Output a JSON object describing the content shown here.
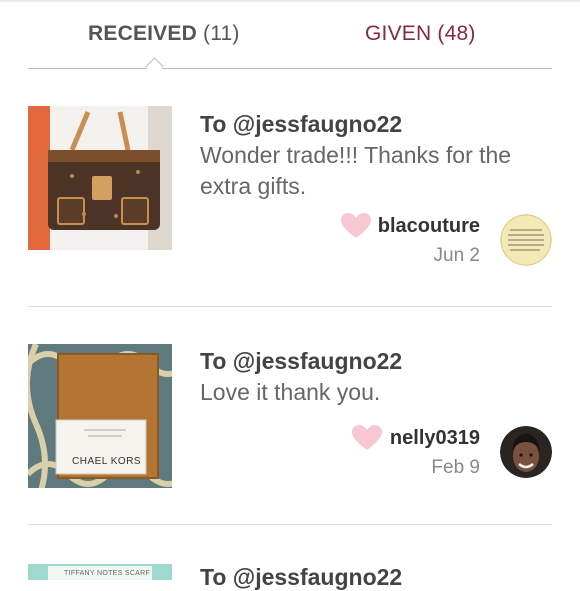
{
  "tabs": {
    "received": {
      "label": "RECEIVED",
      "count": "(11)"
    },
    "given": {
      "label": "GIVEN",
      "count": "(48)"
    }
  },
  "items": [
    {
      "to": "To @jessfaugno22",
      "comment": "Wonder trade!!! Thanks for the extra gifts.",
      "username": "blacouture",
      "date": "Jun 2",
      "thumb_icon": "handbag-photo",
      "avatar_icon": "text-avatar"
    },
    {
      "to": "To @jessfaugno22",
      "comment": "Love it thank you.",
      "username": "nelly0319",
      "date": "Feb 9",
      "thumb_icon": "wallet-photo",
      "thumb_caption": "CHAEL KORS",
      "avatar_icon": "person-avatar"
    },
    {
      "to": "To @jessfaugno22",
      "thumb_icon": "scarf-box-photo",
      "thumb_caption": "TIFFANY NOTES SCARF"
    }
  ],
  "colors": {
    "given_tab": "#822b3e",
    "heart": "#f7c8d2",
    "divider": "#dcdcdc"
  }
}
